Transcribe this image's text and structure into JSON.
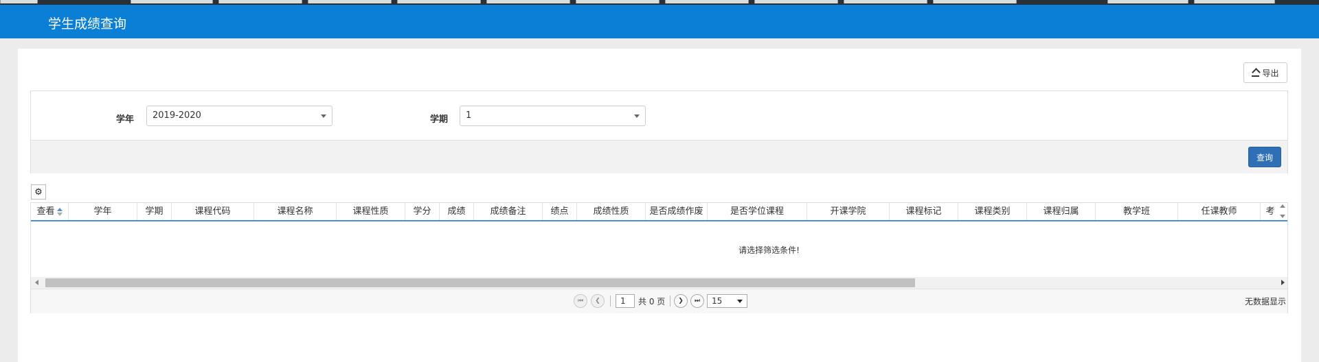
{
  "header": {
    "title": "学生成绩查询"
  },
  "toolbar": {
    "export_label": "导出",
    "export_icon": "export-icon"
  },
  "filters": {
    "year_label": "学年",
    "year_value": "2019-2020",
    "term_label": "学期",
    "term_value": "1",
    "query_label": "查询"
  },
  "grid": {
    "settings_icon": "gear-icon",
    "columns": [
      "查看",
      "学年",
      "学期",
      "课程代码",
      "课程名称",
      "课程性质",
      "学分",
      "成绩",
      "成绩备注",
      "绩点",
      "成绩性质",
      "是否成绩作废",
      "是否学位课程",
      "开课学院",
      "课程标记",
      "课程类别",
      "课程归属",
      "教学班",
      "任课教师",
      "考"
    ],
    "empty_message": "请选择筛选条件!"
  },
  "pager": {
    "current_page": "1",
    "total_text": "共 0 页",
    "page_size": "15",
    "status_text": "无数据显示"
  }
}
